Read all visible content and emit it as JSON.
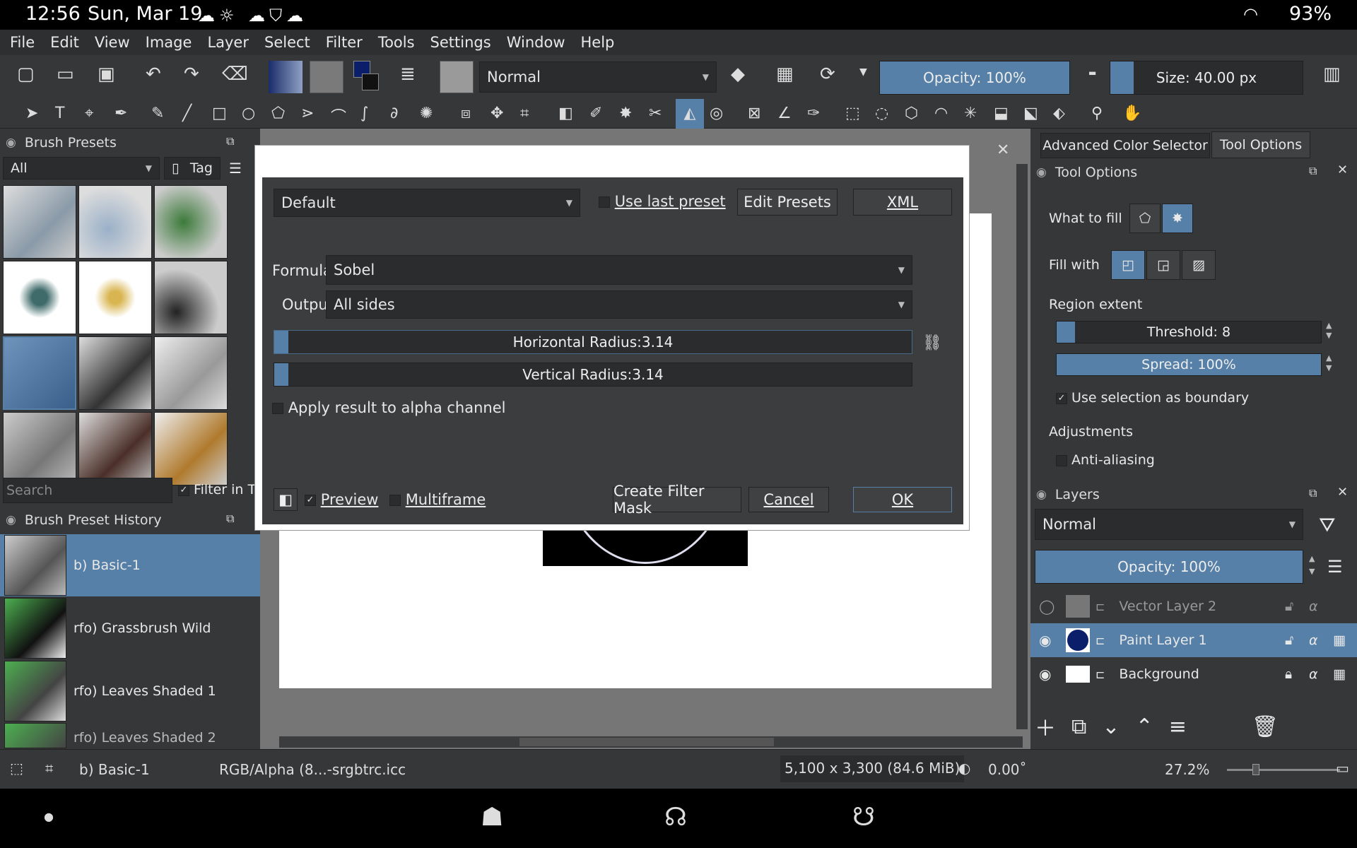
{
  "status": {
    "time": "12:56",
    "date": "Sun, Mar 19",
    "battery": "93%"
  },
  "menu": [
    "File",
    "Edit",
    "View",
    "Image",
    "Layer",
    "Select",
    "Filter",
    "Tools",
    "Settings",
    "Window",
    "Help"
  ],
  "toolbar": {
    "blend_mode": "Normal",
    "opacity": "Opacity: 100%",
    "opacity_value": 1.0,
    "size": "Size: 40.00 px",
    "size_fill": 0.12
  },
  "brush_presets": {
    "title": "Brush Presets",
    "filter": "All",
    "tag": "Tag",
    "search_placeholder": "Search",
    "filter_in_tag": "Filter in Ta"
  },
  "history": {
    "title": "Brush Preset History",
    "items": [
      "b) Basic-1",
      "rfo) Grassbrush Wild",
      "rfo) Leaves Shaded 1",
      "rfo) Leaves Shaded 2"
    ]
  },
  "dialog": {
    "preset": "Default",
    "use_last_preset": "Use last preset",
    "edit_presets": "Edit Presets",
    "xml": "XML",
    "formula_label": "Formula:",
    "formula": "Sobel",
    "output_label": "Output:",
    "output": "All sides",
    "hradius": "Horizontal Radius:3.14",
    "vradius": "Vertical Radius:3.14",
    "apply_alpha": "Apply result to alpha channel",
    "preview": "Preview",
    "multiframe": "Multiframe",
    "create_mask": "Create Filter Mask",
    "cancel": "Cancel",
    "ok": "OK"
  },
  "right": {
    "tab_color": "Advanced Color Selector",
    "tab_tool": "Tool Options",
    "tool_options_title": "Tool Options",
    "what_to_fill": "What to fill",
    "fill_with": "Fill with",
    "region_extent": "Region extent",
    "threshold": "Threshold: 8",
    "threshold_fill": 0.04,
    "spread": "Spread: 100%",
    "spread_fill": 1.0,
    "use_selection": "Use selection as boundary",
    "adjustments": "Adjustments",
    "antialiasing": "Anti-aliasing"
  },
  "layers": {
    "title": "Layers",
    "blend": "Normal",
    "opacity": "Opacity:  100%",
    "opacity_fill": 1.0,
    "items": [
      {
        "name": "Vector Layer 2"
      },
      {
        "name": "Paint Layer 1"
      },
      {
        "name": "Background"
      }
    ]
  },
  "bottom": {
    "brush": "b) Basic-1",
    "colorspace": "RGB/Alpha (8...-srgbtrc.icc",
    "dimensions": "5,100 x 3,300 (84.6 MiB)",
    "rotation": "0.00˚",
    "zoom": "27.2%"
  },
  "colors": {
    "accent": "#5680a7",
    "panel": "#353739",
    "dark": "#2a2c2e"
  }
}
